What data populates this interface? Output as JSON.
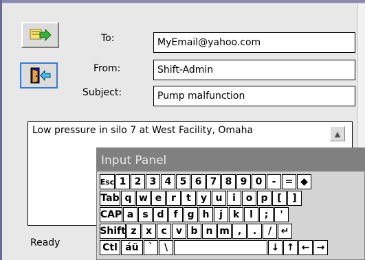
{
  "compose": {
    "to_label": "To:",
    "to_value": "MyEmail@yahoo.com",
    "from_label": "From:",
    "from_value": "Shift-Admin",
    "subject_label": "Subject:",
    "subject_value": "Pump malfunction",
    "body_text": "Low pressure in silo  7 at West Facility, Omaha",
    "status_text": "Ready"
  },
  "icons": {
    "send": "send-mail-icon",
    "exit": "exit-door-icon",
    "scroll_up": "scroll-up-arrow-icon"
  },
  "colors": {
    "window_border": "#6a6a9a",
    "panel_bg": "#e8e8e8",
    "input_panel_title_bg": "#808080",
    "exit_button_focus": "#3b79c9"
  },
  "input_panel": {
    "title": "Input Panel",
    "rows": [
      [
        "Esc",
        "1",
        "2",
        "3",
        "4",
        "5",
        "6",
        "7",
        "8",
        "9",
        "0",
        "-",
        "=",
        "◆"
      ],
      [
        "Tab",
        "q",
        "w",
        "e",
        "r",
        "t",
        "y",
        "u",
        "i",
        "o",
        "p",
        "[",
        "]"
      ],
      [
        "CAP",
        "a",
        "s",
        "d",
        "f",
        "g",
        "h",
        "j",
        "k",
        "l",
        ";",
        "'"
      ],
      [
        "Shift",
        "z",
        "x",
        "c",
        "v",
        "b",
        "n",
        "m",
        ",",
        ".",
        "/",
        "↵"
      ],
      [
        "Ctl",
        "áü",
        "`",
        "\\",
        " ",
        "↓",
        "↑",
        "←",
        "→"
      ]
    ]
  }
}
